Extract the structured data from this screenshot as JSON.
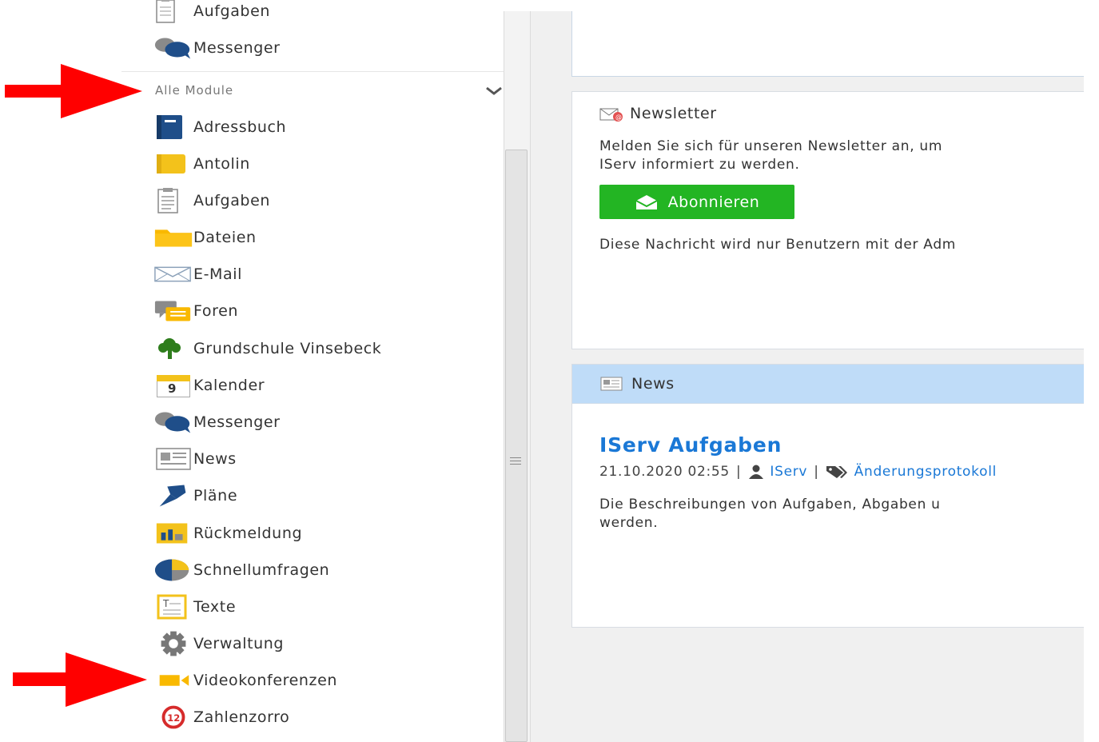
{
  "sidebar": {
    "top_items": [
      {
        "label": "Aufgaben",
        "icon": "tasks-icon"
      },
      {
        "label": "Messenger",
        "icon": "messenger-icon"
      }
    ],
    "section_title": "Alle Module",
    "modules": [
      {
        "label": "Adressbuch",
        "icon": "addressbook-icon"
      },
      {
        "label": "Antolin",
        "icon": "antolin-icon"
      },
      {
        "label": "Aufgaben",
        "icon": "tasks-icon"
      },
      {
        "label": "Dateien",
        "icon": "folder-icon"
      },
      {
        "label": "E-Mail",
        "icon": "mail-icon"
      },
      {
        "label": "Foren",
        "icon": "forum-icon"
      },
      {
        "label": "Grundschule Vinsebeck",
        "icon": "tree-icon"
      },
      {
        "label": "Kalender",
        "icon": "calendar-icon"
      },
      {
        "label": "Messenger",
        "icon": "messenger-icon"
      },
      {
        "label": "News",
        "icon": "news-icon"
      },
      {
        "label": "Pläne",
        "icon": "pin-icon"
      },
      {
        "label": "Rückmeldung",
        "icon": "feedback-icon"
      },
      {
        "label": "Schnellumfragen",
        "icon": "pie-chart-icon"
      },
      {
        "label": "Texte",
        "icon": "text-document-icon"
      },
      {
        "label": "Verwaltung",
        "icon": "gear-icon"
      },
      {
        "label": "Videokonferenzen",
        "icon": "video-camera-icon"
      },
      {
        "label": "Zahlenzorro",
        "icon": "zahlenzorro-icon"
      }
    ],
    "calendar_day": "9"
  },
  "newsletter": {
    "title": "Newsletter",
    "text_line1": "Melden Sie sich für unseren Newsletter an, um",
    "text_line2": "IServ informiert zu werden.",
    "button_label": "Abonnieren",
    "admin_note": "Diese Nachricht wird nur Benutzern mit der Adm"
  },
  "news": {
    "header": "News",
    "article_title": "IServ Aufgaben",
    "date": "21.10.2020 02:55",
    "separator": "|",
    "author": "IServ",
    "category": "Änderungsprotokoll",
    "text_line1": "Die Beschreibungen von Aufgaben, Abgaben u",
    "text_line2": "werden."
  },
  "colors": {
    "arrow": "#ff0000",
    "button_green": "#23b523",
    "link_blue": "#1a78d6",
    "news_header_bg": "#bfdcf8",
    "icon_navy": "#1f4e89",
    "icon_yellow": "#f3c21b"
  }
}
